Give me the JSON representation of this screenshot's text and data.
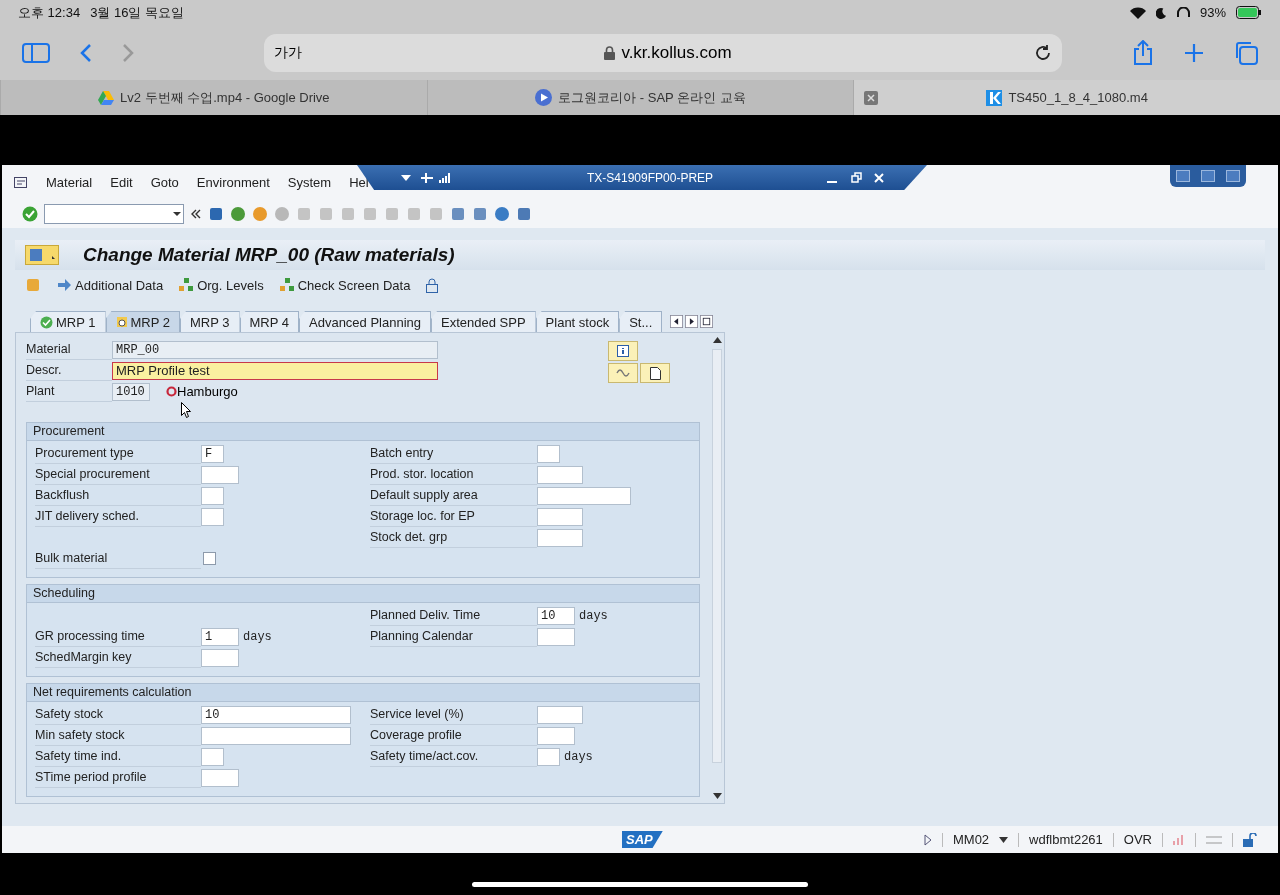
{
  "device_status": {
    "time": "오후 12:34",
    "date": "3월 16일 목요일",
    "battery": "93%"
  },
  "browser": {
    "text_size": "가가",
    "url": "v.kr.kollus.com",
    "tabs": [
      {
        "label": "Lv2 두번째 수업.mp4 - Google Drive",
        "selected": false,
        "kind": "drive"
      },
      {
        "label": "로그원코리아 - SAP 온라인 교육",
        "selected": false,
        "kind": "play"
      },
      {
        "label": "TS450_1_8_4_1080.m4",
        "selected": true,
        "kind": "k"
      }
    ]
  },
  "sap": {
    "menu": [
      "Material",
      "Edit",
      "Goto",
      "Environment",
      "System",
      "Hel"
    ],
    "window_title": "TX-S41909FP00-PREP",
    "page_title": "Change Material MRP_00 (Raw materials)",
    "app_toolbar": [
      "Additional Data",
      "Org. Levels",
      "Check Screen Data"
    ],
    "tabs": [
      {
        "label": "MRP 1",
        "selected": false,
        "maintained": true
      },
      {
        "label": "MRP 2",
        "selected": true,
        "maintained": true
      },
      {
        "label": "MRP 3",
        "selected": false,
        "maintained": false
      },
      {
        "label": "MRP 4",
        "selected": false,
        "maintained": false
      },
      {
        "label": "Advanced Planning",
        "selected": false,
        "maintained": false
      },
      {
        "label": "Extended SPP",
        "selected": false,
        "maintained": false
      },
      {
        "label": "Plant stock",
        "selected": false,
        "maintained": false
      },
      {
        "label": "St...",
        "selected": false,
        "maintained": false
      }
    ],
    "header": {
      "material": {
        "label": "Material",
        "value": "MRP_00"
      },
      "description": {
        "label": "Descr.",
        "value": "MRP Profile test",
        "focused": true
      },
      "plant": {
        "label": "Plant",
        "value": "1010",
        "name": "Hamburgo"
      }
    },
    "sections": [
      {
        "title": "Procurement",
        "rows": [
          {
            "left": {
              "label": "Procurement type",
              "kind": "indicator",
              "value": "F"
            },
            "right": {
              "label": "Batch entry",
              "kind": "indicator"
            }
          },
          {
            "left": {
              "label": "Special procurement",
              "kind": "key"
            },
            "right": {
              "label": "Prod. stor. location",
              "kind": "code"
            }
          },
          {
            "left": {
              "label": "Backflush",
              "kind": "indicator"
            },
            "right": {
              "label": "Default supply area",
              "kind": "wide"
            }
          },
          {
            "left": {
              "label": "JIT delivery sched.",
              "kind": "indicator"
            },
            "right": {
              "label": "Storage loc. for EP",
              "kind": "code"
            }
          },
          {
            "right": {
              "label": "Stock det. grp",
              "kind": "code"
            }
          },
          {
            "left": {
              "label": "Bulk material",
              "kind": "checkbox",
              "checked": false
            }
          }
        ]
      },
      {
        "title": "Scheduling",
        "rows": [
          {
            "right": {
              "label": "Planned Deliv. Time",
              "kind": "key",
              "value": "10",
              "unit": "days"
            }
          },
          {
            "left": {
              "label": "GR processing time",
              "kind": "key",
              "value": "1",
              "unit": "days"
            },
            "right": {
              "label": "Planning Calendar",
              "kind": "key"
            }
          },
          {
            "left": {
              "label": "SchedMargin key",
              "kind": "key"
            }
          }
        ]
      },
      {
        "title": "Net requirements calculation",
        "rows": [
          {
            "left": {
              "label": "Safety stock",
              "kind": "amount",
              "value": "10"
            },
            "right": {
              "label": "Service level (%)",
              "kind": "code"
            }
          },
          {
            "left": {
              "label": "Min safety stock",
              "kind": "amount"
            },
            "right": {
              "label": "Coverage profile",
              "kind": "key"
            }
          },
          {
            "left": {
              "label": "Safety time ind.",
              "kind": "indicator"
            },
            "right": {
              "label": "Safety time/act.cov.",
              "kind": "indicator",
              "unit": "days"
            }
          },
          {
            "left": {
              "label": "STime period profile",
              "kind": "key"
            }
          }
        ]
      }
    ],
    "status": {
      "logo": "SAP",
      "transaction": "MM02",
      "server": "wdflbmt2261",
      "mode": "OVR"
    }
  }
}
